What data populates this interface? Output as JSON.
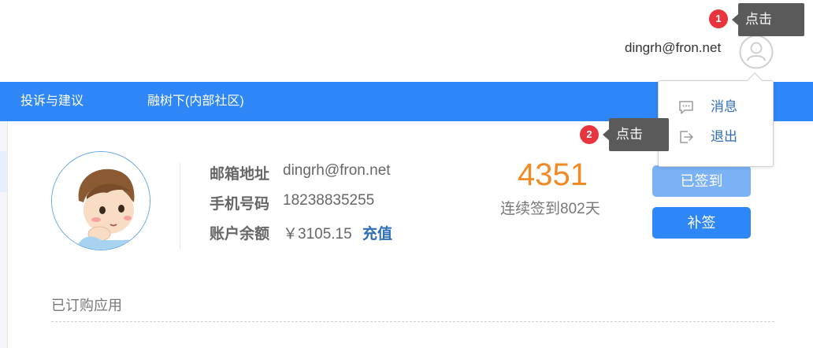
{
  "header": {
    "user_email": "dingrh@fron.net"
  },
  "nav": {
    "items": [
      {
        "label": "投诉与建议"
      },
      {
        "label": "融树下(内部社区)"
      }
    ]
  },
  "profile": {
    "email_label": "邮箱地址",
    "email_value": "dingrh@fron.net",
    "phone_label": "手机号码",
    "phone_value": "18238835255",
    "balance_label": "账户余额",
    "balance_value": "￥3105.15",
    "recharge_label": "充值"
  },
  "checkin": {
    "points": "4351",
    "streak_text": "连续签到802天",
    "signed_label": "已签到",
    "makeup_label": "补签"
  },
  "subscribed": {
    "title": "已订购应用"
  },
  "dropdown": {
    "items": [
      {
        "label": "消息",
        "icon": "message-icon"
      },
      {
        "label": "退出",
        "icon": "logout-icon"
      }
    ]
  },
  "annotations": [
    {
      "number": "1",
      "text": "点击"
    },
    {
      "number": "2",
      "text": "点击"
    }
  ],
  "colors": {
    "nav_bg": "#2f86f6",
    "points": "#f08a24",
    "link": "#2f6db5",
    "badge": "#e8343c",
    "tooltip_bg": "#5a5a5a"
  }
}
